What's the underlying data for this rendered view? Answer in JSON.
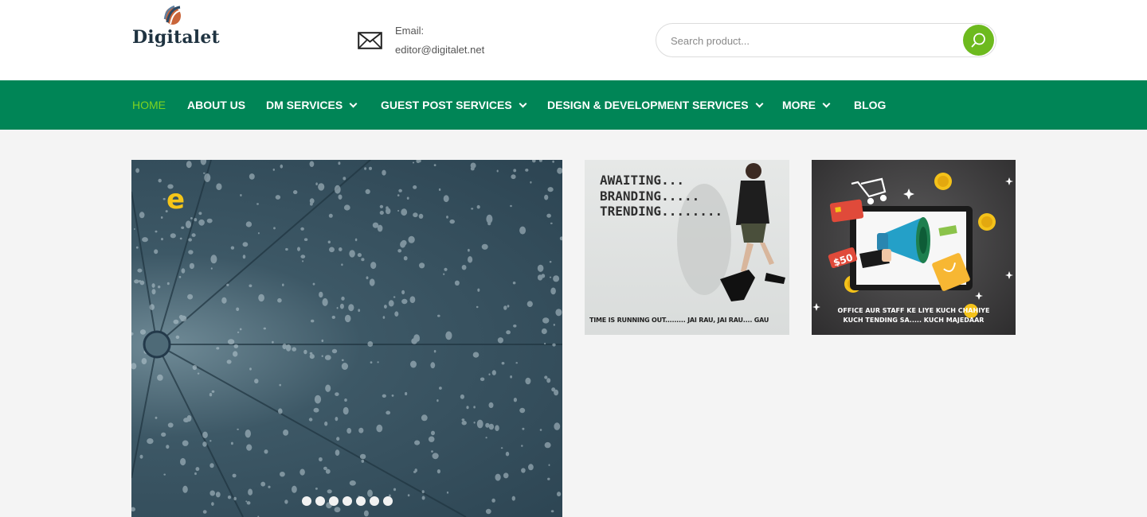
{
  "header": {
    "logo_text": "Digitalet",
    "contact_label": "Email:",
    "contact_value": "editor@digitalet.net",
    "search_placeholder": "Search product..."
  },
  "nav": {
    "items": [
      {
        "label": "HOME",
        "active": true,
        "has_dropdown": false
      },
      {
        "label": "ABOUT US",
        "active": false,
        "has_dropdown": false
      },
      {
        "label": "DM SERVICES",
        "active": false,
        "has_dropdown": true
      },
      {
        "label": "GUEST POST SERVICES",
        "active": false,
        "has_dropdown": true
      },
      {
        "label": "DESIGN & DEVELOPMENT SERVICES",
        "active": false,
        "has_dropdown": true
      },
      {
        "label": "MORE",
        "active": false,
        "has_dropdown": true
      },
      {
        "label": "BLOG",
        "active": false,
        "has_dropdown": false
      }
    ]
  },
  "slider": {
    "overlay_letter": "e",
    "dot_count": 7
  },
  "cards": [
    {
      "lines": [
        "AWAITING...",
        "BRANDING.....",
        "TRENDING........"
      ],
      "footer": "TIME IS RUNNING OUT......... JAI RAU, JAI RAU.... GAU"
    },
    {
      "price_tag": "$50",
      "caption_line1": "OFFICE AUR STAFF KE LIYE KUCH CHAHIYE",
      "caption_line2": "KUCH TENDING SA..... KUCH MAJEDAAR"
    }
  ],
  "colors": {
    "nav_bg": "#008556",
    "active_nav": "#7ed321",
    "search_button": "#6dba1e",
    "page_bg": "#f4f4f4"
  },
  "icons": {
    "contact": "envelope-icon",
    "search": "search-icon",
    "dropdown": "chevron-down-icon"
  }
}
